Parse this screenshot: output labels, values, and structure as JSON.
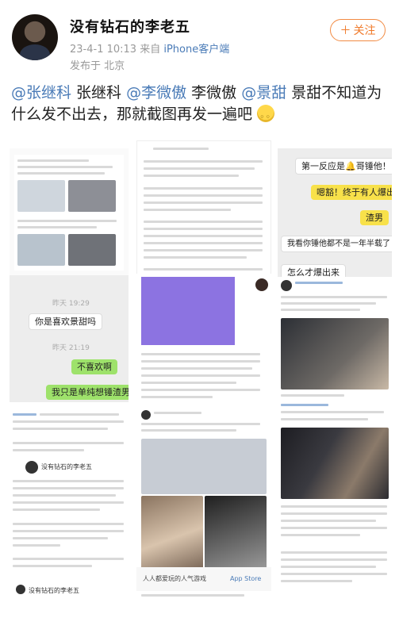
{
  "post": {
    "username": "没有钻石的李老五",
    "date": "23-4-1 10:13",
    "source_prefix": "来自",
    "source_client": "iPhone客户端",
    "location": "发布于 北京",
    "follow_label": "关注",
    "follow_icon": "plus-icon",
    "content": {
      "mention1": "@张继科",
      "name1": " 张继科 ",
      "mention2": "@李微傲",
      "name2": " 李微傲 ",
      "mention3": "@景甜",
      "text_tail": " 景甜不知道为什么发不出去，那就截图再发一遍吧"
    }
  },
  "screens": {
    "chat1": {
      "b1": "第一反应是🔔哥锤他！",
      "b2": "嗯豁！终于有人爆出来",
      "b3": "渣男",
      "b4": "我看你锤他都不是一年半载了",
      "b5": "怎么才爆出来"
    },
    "chat2": {
      "time1": "昨天 19:29",
      "b1": "你是喜欢景甜吗",
      "time2": "昨天 21:19",
      "b2": "不喜欢啊",
      "b3": "我只是单纯想锤渣男"
    },
    "feed_names": {
      "a": "没有钻石的李老五",
      "b": "没有钻石的李老五"
    },
    "footer_app": "人人都爱玩的人气游戏",
    "footer_store": "App Store"
  },
  "colors": {
    "accent_orange": "#f07a2a",
    "link_blue": "#4a7bb7",
    "chat_yellow": "#f8e14a",
    "chat_green": "#9ee26b"
  }
}
